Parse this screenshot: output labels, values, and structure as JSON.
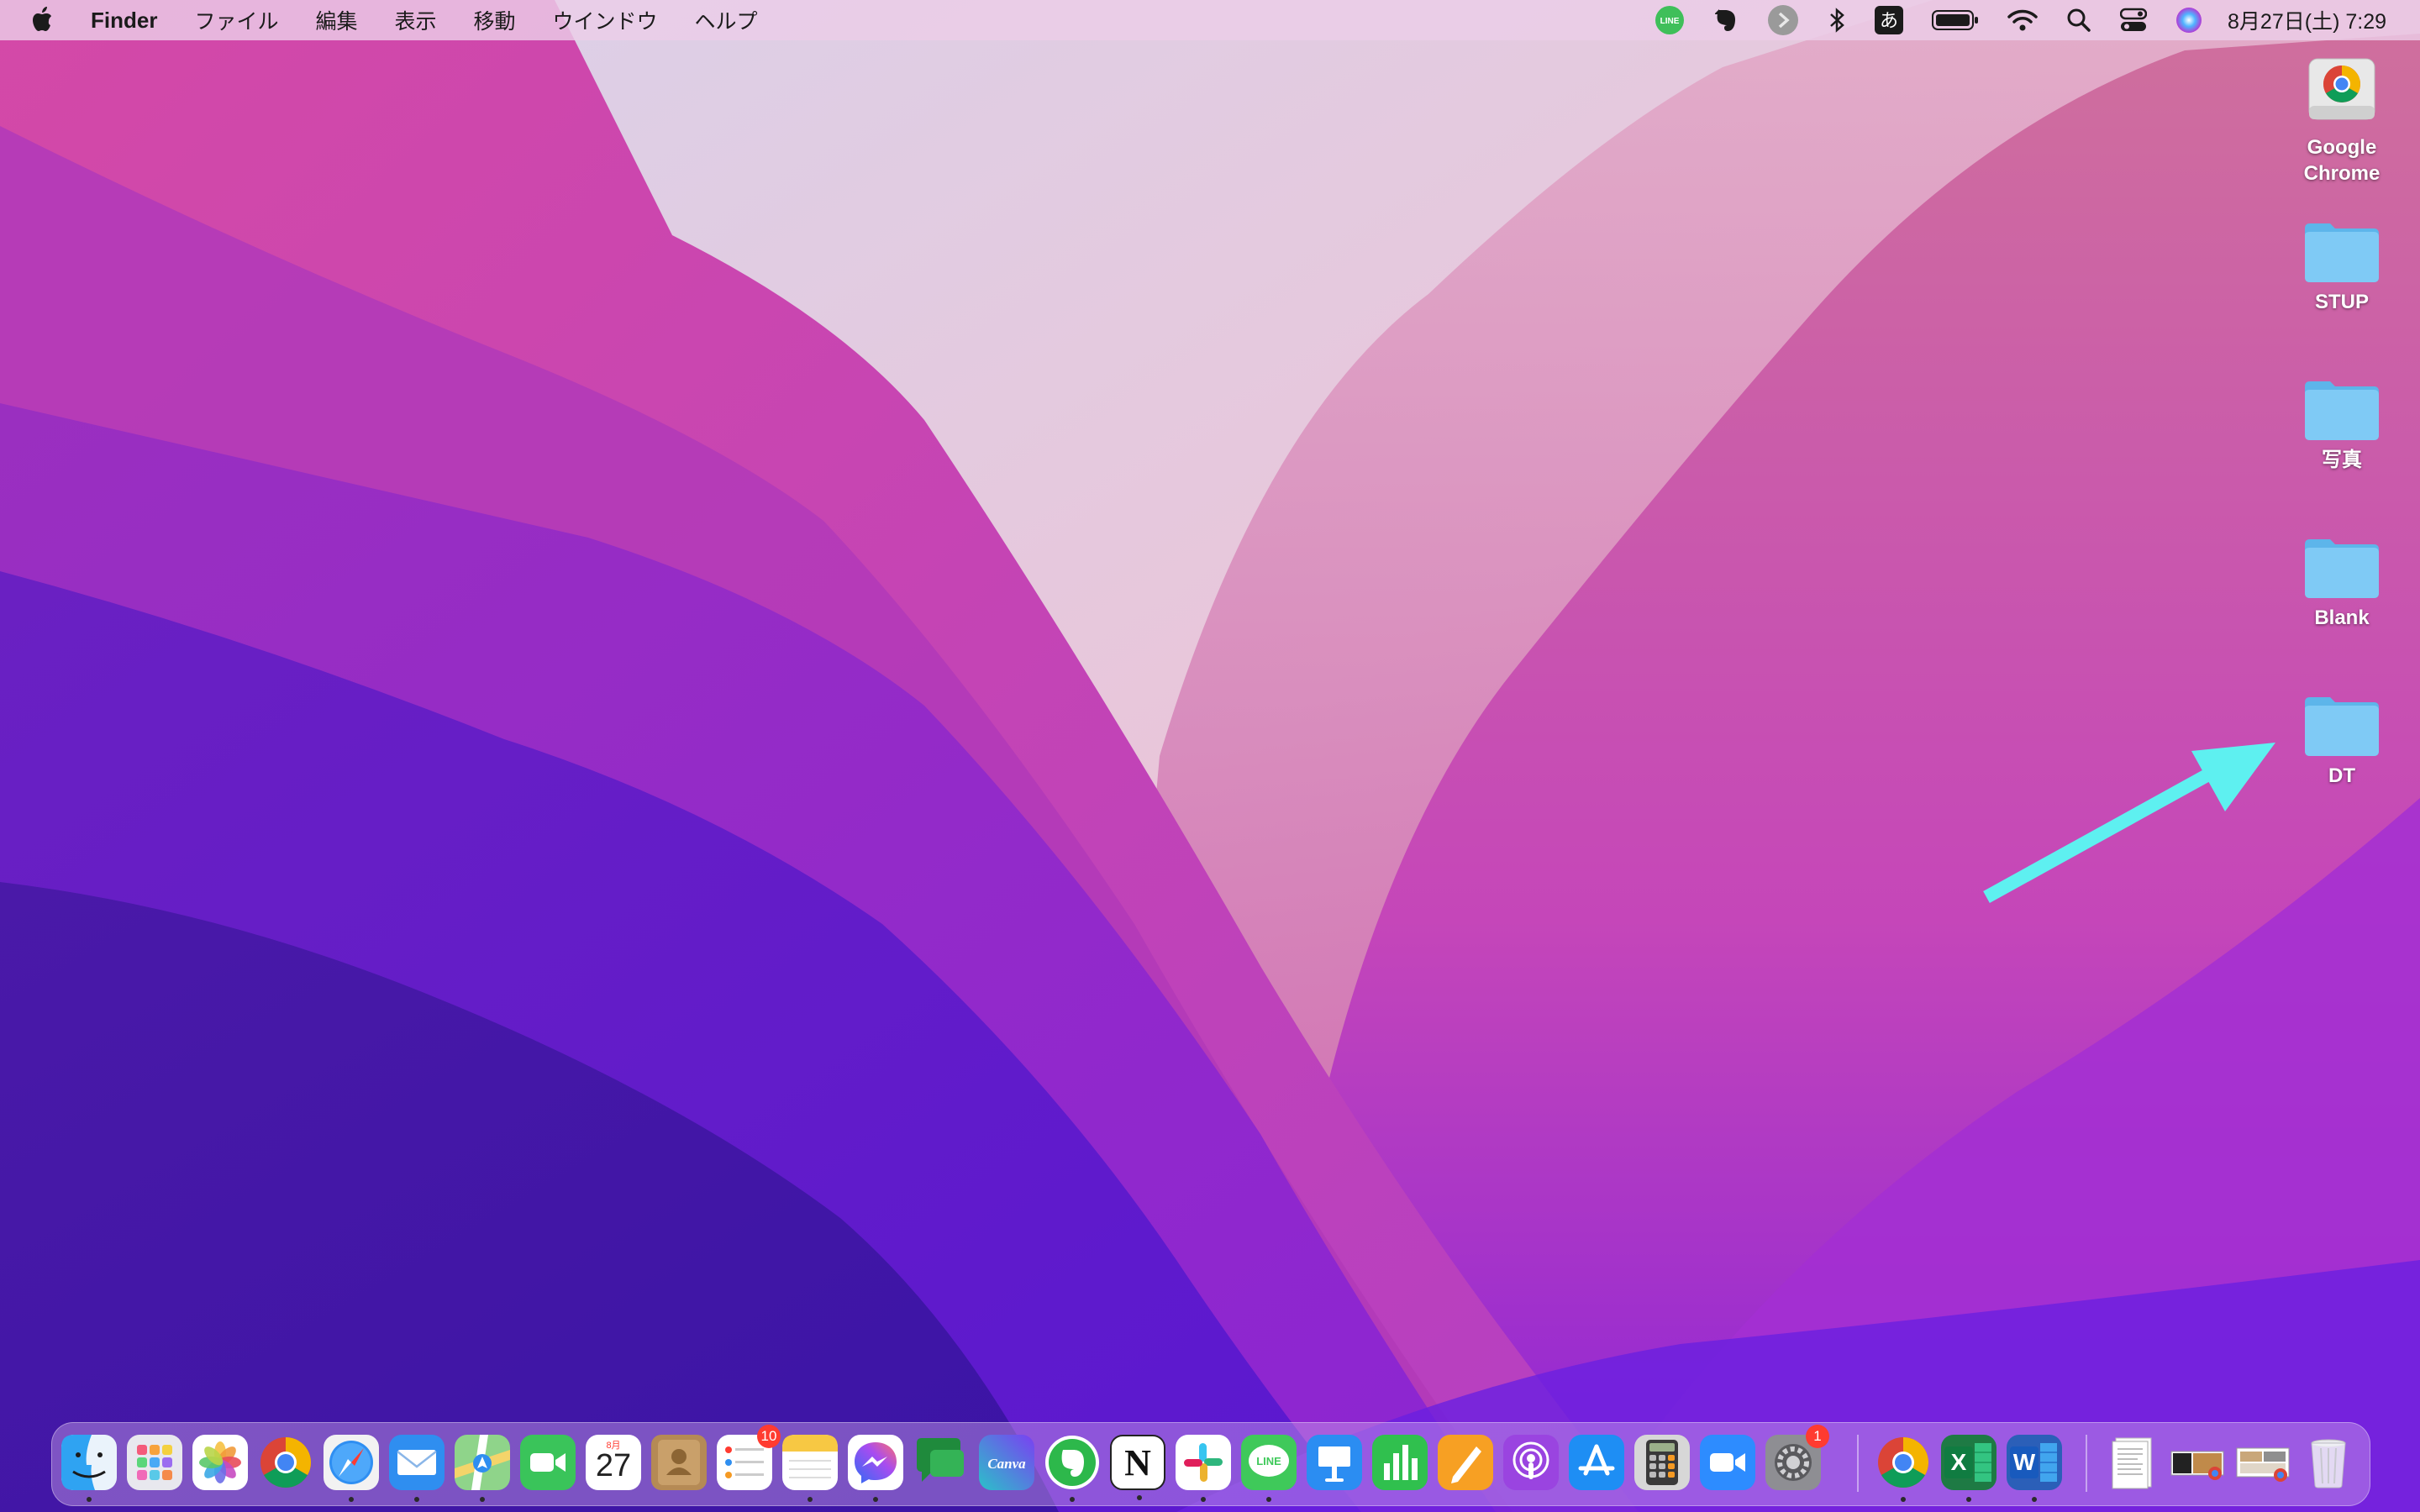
{
  "menubar": {
    "app_name": "Finder",
    "menus": [
      "ファイル",
      "編集",
      "表示",
      "移動",
      "ウインドウ",
      "ヘルプ"
    ],
    "status_icons": [
      "line-icon",
      "evernote-icon",
      "forward-icon",
      "bluetooth-icon",
      "input-method-icon",
      "battery-icon",
      "wifi-icon",
      "spotlight-icon",
      "control-center-icon",
      "siri-icon"
    ],
    "input_method_label": "あ",
    "line_label": "LINE",
    "clock": "8月27日(土)  7:29"
  },
  "desktop": {
    "icons": [
      {
        "label": "Google Chrome",
        "icon": "chrome-disk-icon"
      },
      {
        "label": "STUP",
        "icon": "folder-icon"
      },
      {
        "label": "写真",
        "icon": "folder-icon"
      },
      {
        "label": "Blank",
        "icon": "folder-icon"
      },
      {
        "label": "DT",
        "icon": "folder-icon"
      }
    ],
    "annotation_color": "#5ef0f0"
  },
  "dock": {
    "apps": [
      {
        "name": "finder",
        "running": true
      },
      {
        "name": "launchpad",
        "running": false
      },
      {
        "name": "photos",
        "running": false
      },
      {
        "name": "chrome",
        "running": false
      },
      {
        "name": "safari",
        "running": true
      },
      {
        "name": "mail",
        "running": true
      },
      {
        "name": "maps",
        "running": true
      },
      {
        "name": "facetime",
        "running": false
      },
      {
        "name": "calendar",
        "running": false
      },
      {
        "name": "contacts",
        "running": false
      },
      {
        "name": "reminders",
        "running": false,
        "badge": "10"
      },
      {
        "name": "notes",
        "running": true
      },
      {
        "name": "messenger",
        "running": true
      },
      {
        "name": "messages",
        "running": false
      },
      {
        "name": "canva",
        "running": false
      },
      {
        "name": "evernote",
        "running": true
      },
      {
        "name": "notion",
        "running": true
      },
      {
        "name": "slack",
        "running": true
      },
      {
        "name": "line",
        "running": true
      },
      {
        "name": "keynote",
        "running": false
      },
      {
        "name": "numbers",
        "running": false
      },
      {
        "name": "pages",
        "running": false
      },
      {
        "name": "podcasts",
        "running": false
      },
      {
        "name": "app-store",
        "running": false
      },
      {
        "name": "calculator",
        "running": false
      },
      {
        "name": "zoom",
        "running": false
      },
      {
        "name": "system-preferences",
        "running": false,
        "badge": "1"
      },
      {
        "name": "chrome-2",
        "running": true
      },
      {
        "name": "excel",
        "running": true
      },
      {
        "name": "word",
        "running": true
      },
      {
        "name": "document-stack",
        "running": false
      },
      {
        "name": "screenshot-stack-1",
        "running": false
      },
      {
        "name": "screenshot-stack-2",
        "running": false
      },
      {
        "name": "trash",
        "running": false
      }
    ],
    "calendar_month": "8月",
    "calendar_day": "27",
    "canva_label": "Canva",
    "notion_label": "N",
    "line_label": "LINE",
    "excel_label": "X",
    "word_label": "W"
  }
}
